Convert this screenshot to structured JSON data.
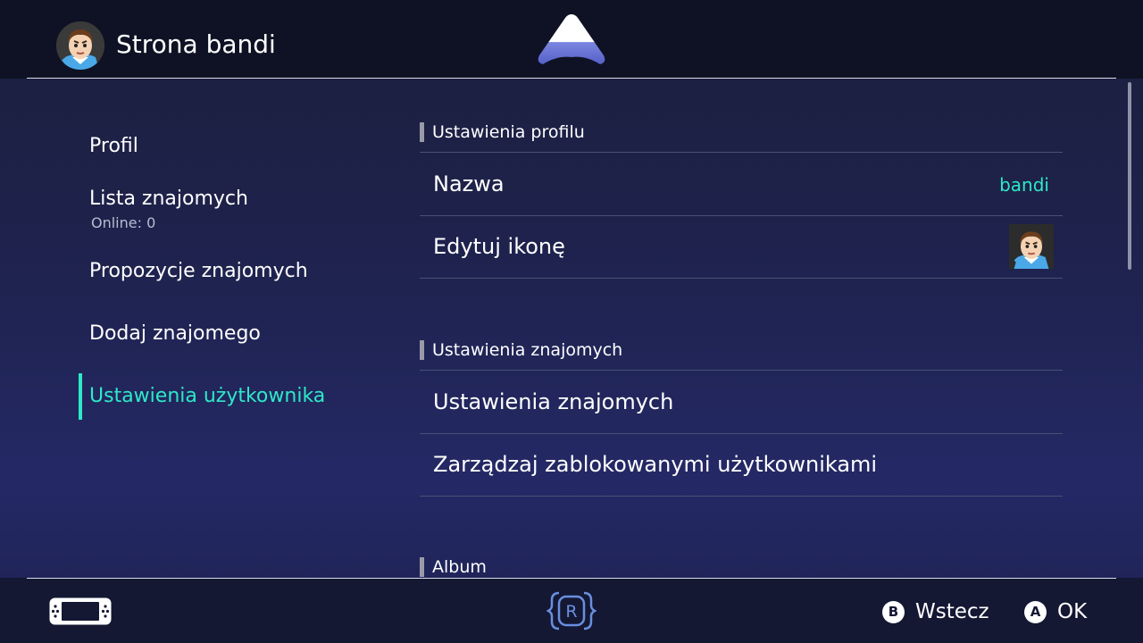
{
  "header": {
    "title": "Strona bandi",
    "avatar_icon": "mii-avatar-icon",
    "logo_icon": "app-logo-icon"
  },
  "sidebar": {
    "items": [
      {
        "label": "Profil"
      },
      {
        "label": "Lista znajomych",
        "sub": "Online: 0"
      },
      {
        "label": "Propozycje znajomych"
      },
      {
        "label": "Dodaj znajomego"
      },
      {
        "label": "Ustawienia użytkownika",
        "active": true
      }
    ]
  },
  "content": {
    "sections": [
      {
        "title": "Ustawienia profilu",
        "rows": [
          {
            "label": "Nazwa",
            "value": "bandi"
          },
          {
            "label": "Edytuj ikonę",
            "icon": "mii-avatar-icon"
          }
        ]
      },
      {
        "title": "Ustawienia znajomych",
        "rows": [
          {
            "label": "Ustawienia znajomych"
          },
          {
            "label": "Zarządzaj zablokowanymi użytkownikami"
          }
        ]
      },
      {
        "title": "Album",
        "rows": []
      }
    ]
  },
  "footer": {
    "console_icon": "handheld-console-icon",
    "center_icon": "r-button-icon",
    "center_letter": "R",
    "back": {
      "button": "B",
      "label": "Wstecz"
    },
    "ok": {
      "button": "A",
      "label": "OK"
    }
  },
  "colors": {
    "accent": "#2ee8c8",
    "header_bg": "#0f1224",
    "background": "#1f2350"
  }
}
